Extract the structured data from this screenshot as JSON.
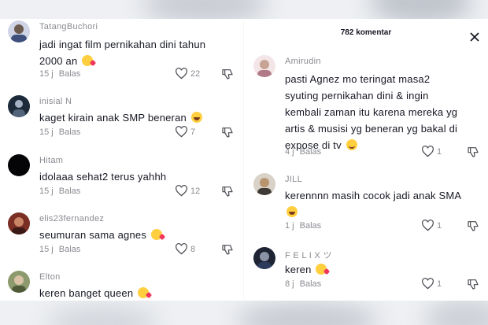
{
  "header": {
    "title": "782 komentar"
  },
  "left_comments": [
    {
      "username": "TatangBuchori",
      "text": "jadi ingat film pernikahan dini tahun 2000 an",
      "emoji": "heart",
      "time": "15 j",
      "reply": "Balas",
      "likes": "22"
    },
    {
      "username": "inisial N",
      "text": "kaget kirain anak SMP beneran",
      "emoji": "laugh",
      "time": "15 j",
      "reply": "Balas",
      "likes": "7"
    },
    {
      "username": "Hitam",
      "text": "idolaaa sehat2 terus yahhh",
      "emoji": "",
      "time": "15 j",
      "reply": "Balas",
      "likes": "12"
    },
    {
      "username": "elis23fernandez",
      "text": "seumuran sama agnes",
      "emoji": "heart",
      "time": "15 j",
      "reply": "Balas",
      "likes": "8"
    },
    {
      "username": "Elton",
      "text": "keren banget queen",
      "emoji": "heart",
      "time": "",
      "reply": "",
      "likes": ""
    }
  ],
  "right_comments": [
    {
      "username": "Amirudin",
      "text": "pasti Agnez mo teringat masa2 syuting pernikahan dini & ingin kembali zaman itu karena mereka yg artis & musisi yg beneran yg bakal di expose di tv",
      "emoji": "smile",
      "time": "4 j",
      "reply": "Balas",
      "likes": "1"
    },
    {
      "username": "JILL",
      "text": "kerennnn masih cocok jadi anak SMA",
      "emoji": "laugh",
      "time": "1 j",
      "reply": "Balas",
      "likes": "1"
    },
    {
      "username": "F E L I X ツ",
      "text": "keren",
      "emoji": "heart",
      "time": "8 j",
      "reply": "Balas",
      "likes": "1"
    }
  ],
  "colors": {
    "text": "#161823",
    "muted": "#8a8b91",
    "background": "#ffffff"
  },
  "icons": {
    "like": "heart-outline-icon",
    "dislike": "thumbs-down-icon",
    "close": "close-icon"
  }
}
